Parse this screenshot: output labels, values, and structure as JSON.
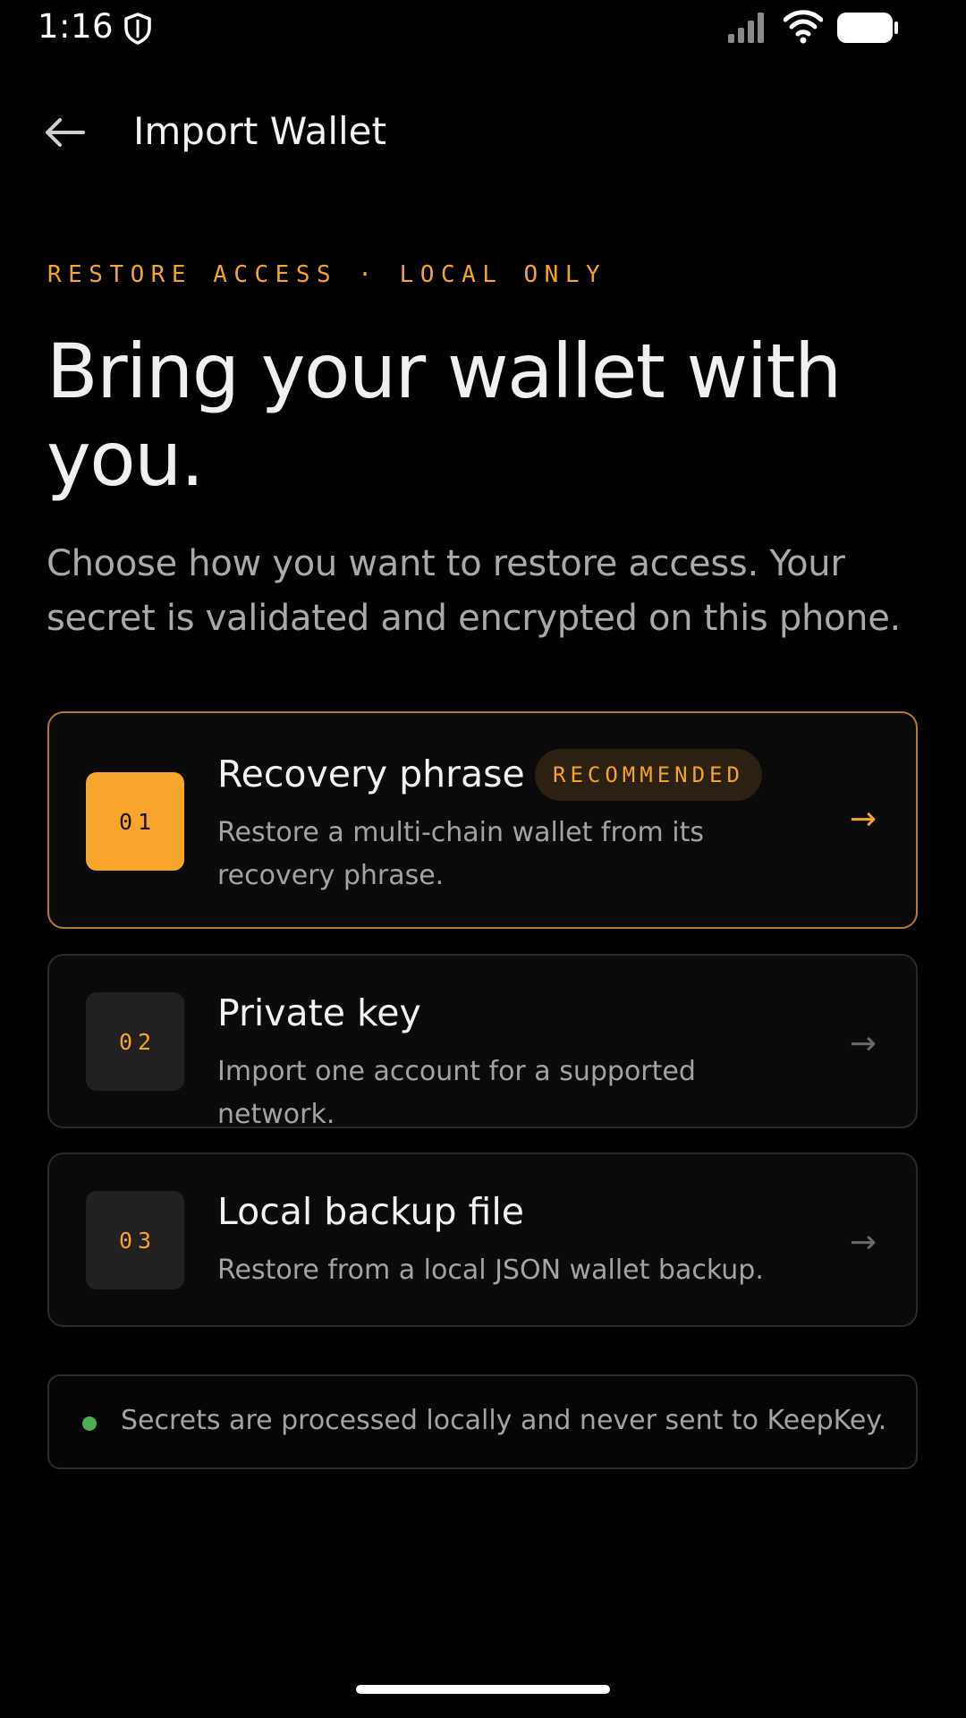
{
  "status_bar": {
    "time": "1:16",
    "icons": [
      "shield-icon",
      "signal-icon",
      "wifi-icon",
      "battery-icon"
    ]
  },
  "header": {
    "back_icon": "arrow-left-icon",
    "title": "Import Wallet"
  },
  "hero": {
    "eyebrow": "RESTORE ACCESS · LOCAL ONLY",
    "title": "Bring your wallet with you.",
    "subtitle": "Choose how you want to restore access. Your secret is validated and encrypted on this phone."
  },
  "options": [
    {
      "number": "01",
      "title": "Recovery phrase",
      "badge": "RECOMMENDED",
      "description": "Restore a multi-chain wallet from its recovery phrase.",
      "arrow": "→"
    },
    {
      "number": "02",
      "title": "Private key",
      "description": "Import one account for a supported network.",
      "arrow": "→"
    },
    {
      "number": "03",
      "title": "Local backup file",
      "description": "Restore from a local JSON wallet backup.",
      "arrow": "→"
    }
  ],
  "notice": {
    "text": "Secrets are processed locally and never sent to KeepKey."
  },
  "colors": {
    "background": "#000000",
    "accent": "#f8a52b",
    "card": "#0b0b0b",
    "card_border": "#2b2b2b",
    "primary_border": "#b57a2b",
    "success_dot": "#4caf50",
    "muted_text": "#a3a3a3"
  }
}
